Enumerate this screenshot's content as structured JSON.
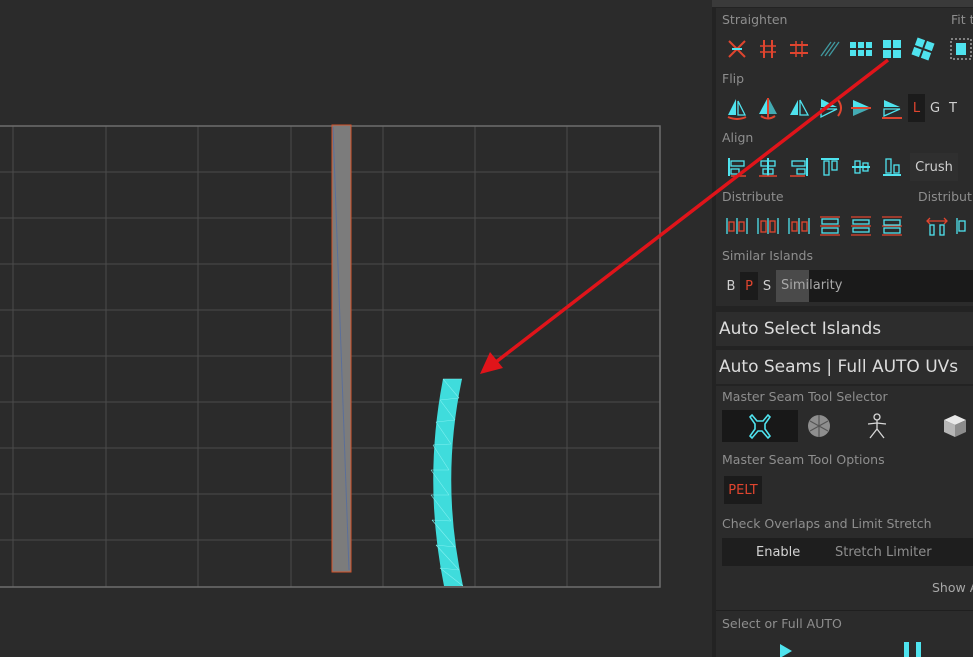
{
  "uv_colors": {
    "grid": "#4b4b4b",
    "grid_border": "#6e6e6e",
    "grey_island": "#7c7c7c",
    "island_outline": "#d4532a",
    "cyan_island": "#3fdcdc",
    "arrow": "#e0141a"
  },
  "panel": {
    "straighten": {
      "label": "Straighten",
      "fit_label": "Fit t"
    },
    "flip": {
      "label": "Flip",
      "letters": [
        "L",
        "G",
        "T"
      ]
    },
    "align": {
      "label": "Align",
      "crush_label": "Crush"
    },
    "distribute": {
      "label": "Distribute",
      "label2": "Distribut"
    },
    "similar_islands": {
      "label": "Similar Islands",
      "letters": [
        "B",
        "P",
        "S"
      ],
      "similarity_label": "Similarity"
    },
    "auto_select_islands": "Auto Select Islands",
    "auto_seams": "Auto Seams | Full AUTO UVs",
    "master_seam_selector": "Master Seam Tool Selector",
    "master_seam_options": "Master Seam Tool Options",
    "pelt_label": "PELT",
    "check_overlaps": "Check Overlaps and Limit Stretch",
    "enable_label": "Enable",
    "stretch_limiter_label": "Stretch Limiter",
    "show_label": "Show A",
    "select_full_auto": "Select or Full AUTO"
  },
  "icon_colors": {
    "accent": "#4fe3ee",
    "alert": "#e0452f",
    "light": "#d8d8d8"
  }
}
